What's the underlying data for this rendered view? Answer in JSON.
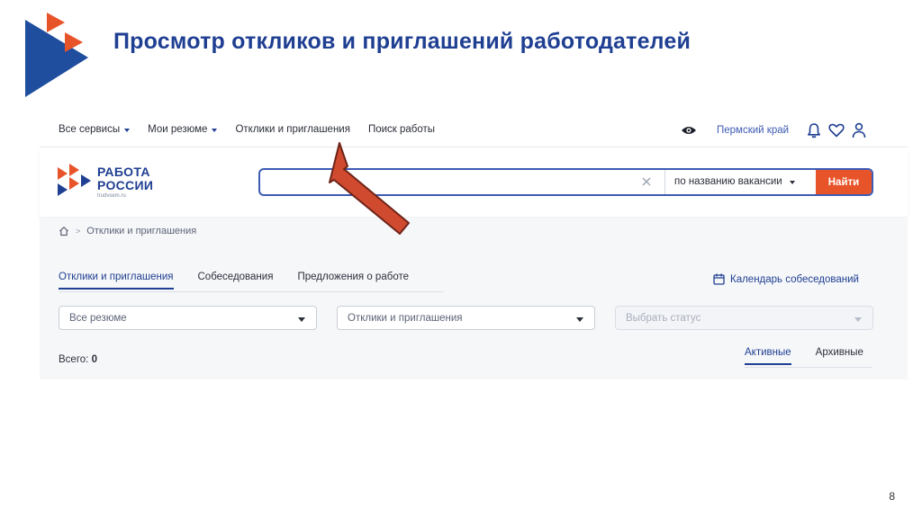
{
  "slide": {
    "title": "Просмотр откликов и приглашений работодателей",
    "page_number": "8"
  },
  "topnav": {
    "items": [
      {
        "label": "Все сервисы",
        "dropdown": true
      },
      {
        "label": "Мои резюме",
        "dropdown": true
      },
      {
        "label": "Отклики и приглашения",
        "dropdown": false
      },
      {
        "label": "Поиск работы",
        "dropdown": false
      }
    ],
    "region": "Пермский край",
    "icons": [
      "eye-icon",
      "bell-icon",
      "heart-icon",
      "user-icon"
    ]
  },
  "brand": {
    "line1": "РАБОТА",
    "line2": "РОССИИ",
    "url": "trudvsem.ru"
  },
  "search": {
    "value": "",
    "mode": "по названию вакансии",
    "button": "Найти"
  },
  "breadcrumb": {
    "current": "Отклики и приглашения"
  },
  "tabs": [
    {
      "label": "Отклики и приглашения",
      "active": true
    },
    {
      "label": "Собеседования",
      "active": false
    },
    {
      "label": "Предложения о работе",
      "active": false
    }
  ],
  "calendar_link": "Календарь собеседований",
  "filters": {
    "resume": "Все резюме",
    "type": "Отклики и приглашения",
    "status_placeholder": "Выбрать статус"
  },
  "total": {
    "label": "Всего:",
    "count": "0"
  },
  "status_tabs": [
    {
      "label": "Активные",
      "active": true
    },
    {
      "label": "Архивные",
      "active": false
    }
  ],
  "colors": {
    "brand_blue": "#1f3f92",
    "accent_orange": "#e8542a",
    "arrow_red": "#d04a2f"
  }
}
